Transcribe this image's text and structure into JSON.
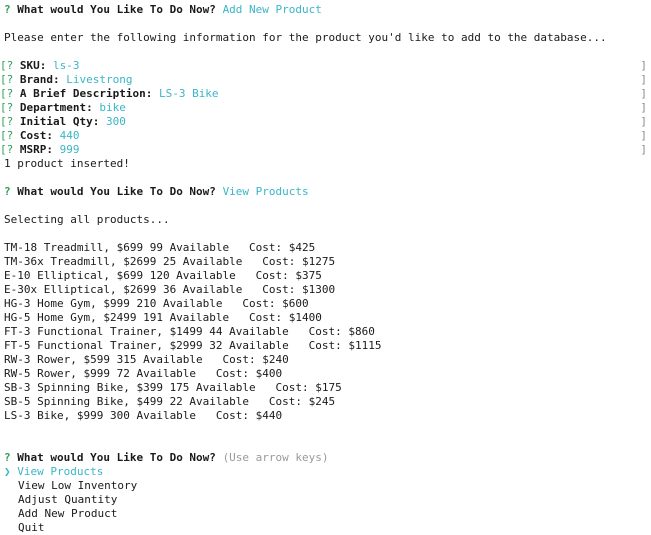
{
  "prompt1": {
    "q_mark": "?",
    "question": "What would You Like To Do Now?",
    "answer": "Add New Product"
  },
  "instructions": "Please enter the following information for the product you'd like to add to the database...",
  "form": {
    "fields": [
      {
        "label": "SKU:",
        "value": "ls-3"
      },
      {
        "label": "Brand:",
        "value": "Livestrong"
      },
      {
        "label": "A Brief Description:",
        "value": "LS-3 Bike"
      },
      {
        "label": "Department:",
        "value": "bike"
      },
      {
        "label": "Initial Qty:",
        "value": "300"
      },
      {
        "label": "Cost:",
        "value": "440"
      },
      {
        "label": "MSRP:",
        "value": "999"
      }
    ],
    "left_bracket": "[?",
    "right_bracket": "]"
  },
  "inserted_message": "1 product inserted!",
  "prompt2": {
    "q_mark": "?",
    "question": "What would You Like To Do Now?",
    "answer": "View Products"
  },
  "selecting_message": "Selecting all products...",
  "products": [
    "TM-18 Treadmill, $699 99 Available   Cost: $425",
    "TM-36x Treadmill, $2699 25 Available   Cost: $1275",
    "E-10 Elliptical, $699 120 Available   Cost: $375",
    "E-30x Elliptical, $2699 36 Available   Cost: $1300",
    "HG-3 Home Gym, $999 210 Available   Cost: $600",
    "HG-5 Home Gym, $2499 191 Available   Cost: $1400",
    "FT-3 Functional Trainer, $1499 44 Available   Cost: $860",
    "FT-5 Functional Trainer, $2999 32 Available   Cost: $1115",
    "RW-3 Rower, $599 315 Available   Cost: $240",
    "RW-5 Rower, $999 72 Available   Cost: $400",
    "SB-3 Spinning Bike, $399 175 Available   Cost: $175",
    "SB-5 Spinning Bike, $499 22 Available   Cost: $245",
    "LS-3 Bike, $999 300 Available   Cost: $440"
  ],
  "prompt3": {
    "q_mark": "?",
    "question": "What would You Like To Do Now?",
    "hint": "(Use arrow keys)"
  },
  "menu": {
    "pointer": "❯",
    "items": [
      "View Products",
      "View Low Inventory",
      "Adjust Quantity",
      "Add New Product",
      "Quit"
    ],
    "selected_index": 0
  },
  "colors": {
    "question_mark": "#2e9e5a",
    "answer": "#39b6c8",
    "hint": "#9a9a9a",
    "text": "#1a1a1a"
  }
}
